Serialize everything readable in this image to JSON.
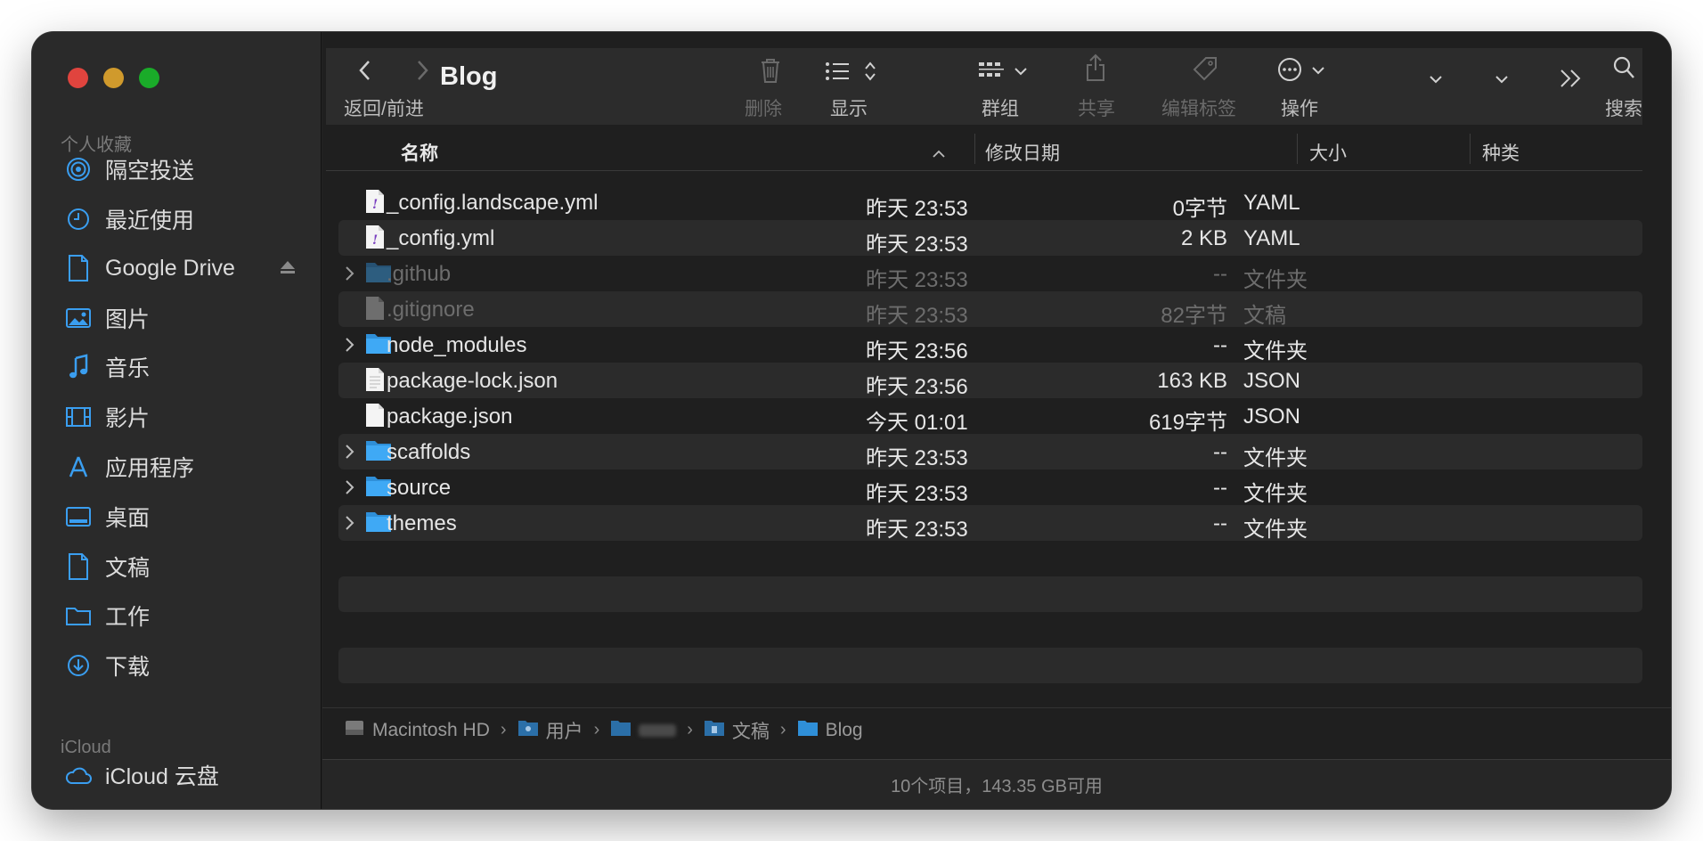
{
  "window": {
    "title": "Blog"
  },
  "sidebar": {
    "favorites_header": "个人收藏",
    "items": [
      {
        "label": "隔空投送",
        "icon": "airdrop-icon"
      },
      {
        "label": "最近使用",
        "icon": "clock-icon"
      },
      {
        "label": "Google Drive",
        "icon": "document-icon"
      },
      {
        "label": "图片",
        "icon": "photos-icon"
      },
      {
        "label": "音乐",
        "icon": "music-icon"
      },
      {
        "label": "影片",
        "icon": "film-icon"
      },
      {
        "label": "应用程序",
        "icon": "applications-icon"
      },
      {
        "label": "桌面",
        "icon": "desktop-icon"
      },
      {
        "label": "文稿",
        "icon": "document-icon"
      },
      {
        "label": "工作",
        "icon": "folder-icon"
      },
      {
        "label": "下载",
        "icon": "download-icon"
      }
    ],
    "icloud_header": "iCloud",
    "icloud_item": {
      "label": "iCloud 云盘",
      "icon": "cloud-icon"
    }
  },
  "toolbar": {
    "back_forward_label": "返回/前进",
    "delete_label": "删除",
    "view_label": "显示",
    "group_label": "群组",
    "share_label": "共享",
    "tags_label": "编辑标签",
    "action_label": "操作",
    "search_label": "搜索"
  },
  "columns": {
    "name": "名称",
    "date": "修改日期",
    "size": "大小",
    "kind": "种类"
  },
  "files": [
    {
      "name": "_config.landscape.yml",
      "date": "昨天 23:53",
      "size": "0字节",
      "kind": "YAML",
      "type": "yaml",
      "folder": false,
      "dim": false
    },
    {
      "name": "_config.yml",
      "date": "昨天 23:53",
      "size": "2 KB",
      "kind": "YAML",
      "type": "yaml",
      "folder": false,
      "dim": false
    },
    {
      "name": ".github",
      "date": "昨天 23:53",
      "size": "--",
      "kind": "文件夹",
      "type": "folder",
      "folder": true,
      "dim": true
    },
    {
      "name": ".gitignore",
      "date": "昨天 23:53",
      "size": "82字节",
      "kind": "文稿",
      "type": "doc",
      "folder": false,
      "dim": true
    },
    {
      "name": "node_modules",
      "date": "昨天 23:56",
      "size": "--",
      "kind": "文件夹",
      "type": "folder",
      "folder": true,
      "dim": false
    },
    {
      "name": "package-lock.json",
      "date": "昨天 23:56",
      "size": "163 KB",
      "kind": "JSON",
      "type": "json",
      "folder": false,
      "dim": false
    },
    {
      "name": "package.json",
      "date": "今天 01:01",
      "size": "619字节",
      "kind": "JSON",
      "type": "json",
      "folder": false,
      "dim": false
    },
    {
      "name": "scaffolds",
      "date": "昨天 23:53",
      "size": "--",
      "kind": "文件夹",
      "type": "folder",
      "folder": true,
      "dim": false
    },
    {
      "name": "source",
      "date": "昨天 23:53",
      "size": "--",
      "kind": "文件夹",
      "type": "folder",
      "folder": true,
      "dim": false
    },
    {
      "name": "themes",
      "date": "昨天 23:53",
      "size": "--",
      "kind": "文件夹",
      "type": "folder",
      "folder": true,
      "dim": false
    }
  ],
  "path": [
    "Macintosh HD",
    "用户",
    "",
    "文稿",
    "Blog"
  ],
  "status": "10个项目，143.35 GB可用",
  "colors": {
    "folder": "#3fa9f5",
    "accent": "#2f9cf0"
  }
}
